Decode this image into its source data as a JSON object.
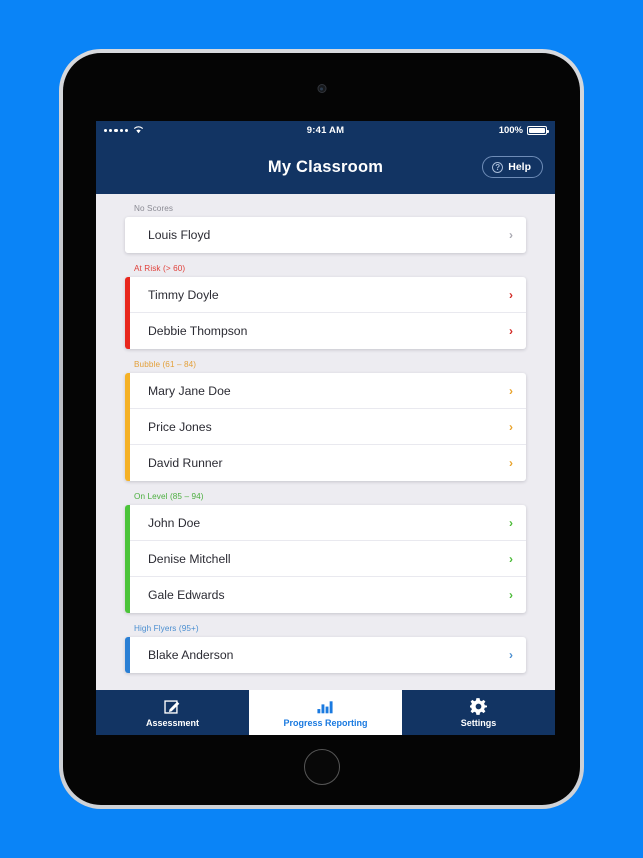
{
  "status_bar": {
    "signal_icon": "signal-dots-icon",
    "wifi_icon": "wifi-icon",
    "time": "9:41 AM",
    "battery_percent": "100%",
    "battery_icon": "battery-full-icon"
  },
  "navbar": {
    "title": "My Classroom",
    "help_label": "Help",
    "help_icon": "question-circle-icon",
    "background": "#123463"
  },
  "sections": [
    {
      "label": "No Scores",
      "label_color": "#8a8a93",
      "accent_color": "transparent",
      "chevron_color": "#a9a9b2",
      "students": [
        "Louis Floyd"
      ]
    },
    {
      "label": "At Risk (> 60)",
      "label_color": "#e0403a",
      "accent_color": "#e8271d",
      "chevron_color": "#d32b26",
      "students": [
        "Timmy Doyle",
        "Debbie Thompson"
      ]
    },
    {
      "label": "Bubble (61 – 84)",
      "label_color": "#e3a03a",
      "accent_color": "#f5b126",
      "chevron_color": "#e8a32c",
      "students": [
        "Mary Jane Doe",
        "Price Jones",
        "David Runner"
      ]
    },
    {
      "label": "On Level (85 – 94)",
      "label_color": "#4caf3f",
      "accent_color": "#4cc43a",
      "chevron_color": "#4cbb38",
      "students": [
        "John Doe",
        "Denise Mitchell",
        "Gale Edwards"
      ]
    },
    {
      "label": "High Flyers (95+)",
      "label_color": "#4a8ed0",
      "accent_color": "#2a7fd4",
      "chevron_color": "#4a8ed0",
      "students": [
        "Blake Anderson"
      ]
    }
  ],
  "tabbar": {
    "tabs": [
      {
        "label": "Assessment",
        "icon": "pencil-square-icon",
        "active": false
      },
      {
        "label": "Progress Reporting",
        "icon": "bar-chart-icon",
        "active": true
      },
      {
        "label": "Settings",
        "icon": "gear-icon",
        "active": false
      }
    ],
    "active_color": "#1a7ae0"
  },
  "chevron_glyph": "›"
}
